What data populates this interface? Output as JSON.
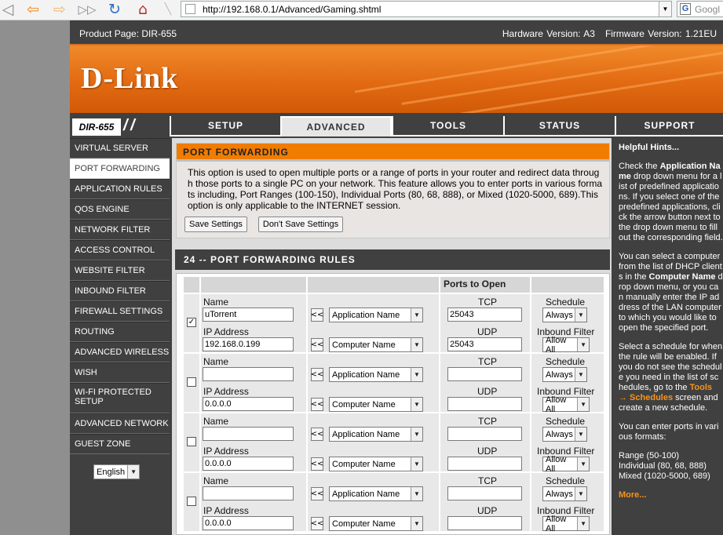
{
  "browser": {
    "url": "http://192.168.0.1/Advanced/Gaming.shtml",
    "search_placeholder": "Googl",
    "search_logo": "G"
  },
  "header": {
    "product": "Product Page: DIR-655",
    "hardware": "Hardware Version: A3",
    "firmware": "Firmware Version: 1.21EU",
    "logo": "D-Link",
    "model": "DIR-655"
  },
  "tabs": [
    "SETUP",
    "ADVANCED",
    "TOOLS",
    "STATUS",
    "SUPPORT"
  ],
  "active_tab": "ADVANCED",
  "nav": [
    "VIRTUAL SERVER",
    "PORT FORWARDING",
    "APPLICATION RULES",
    "QOS ENGINE",
    "NETWORK FILTER",
    "ACCESS CONTROL",
    "WEBSITE FILTER",
    "INBOUND FILTER",
    "FIREWALL SETTINGS",
    "ROUTING",
    "ADVANCED WIRELESS",
    "WISH",
    "WI-FI PROTECTED SETUP",
    "ADVANCED NETWORK",
    "GUEST ZONE"
  ],
  "active_nav": "PORT FORWARDING",
  "language": "English",
  "port_forwarding": {
    "title": "PORT FORWARDING",
    "description": "This option is used to open multiple ports or a range of ports in your router and redirect data through those ports to a single PC on your network. This feature allows you to enter ports in various formats including, Port Ranges (100-150), Individual Ports (80, 68, 888), or Mixed (1020-5000, 689).This option is only applicable to the INTERNET session.",
    "save_label": "Save Settings",
    "dont_save_label": "Don't Save Settings"
  },
  "rules": {
    "title": "24 -- PORT FORWARDING RULES",
    "ports_header": "Ports to Open",
    "labels": {
      "name": "Name",
      "ip": "IP Address",
      "tcp": "TCP",
      "udp": "UDP",
      "schedule": "Schedule",
      "inbound": "Inbound Filter",
      "move": "<<"
    },
    "rows": [
      {
        "checked": true,
        "name": "uTorrent",
        "ip": "192.168.0.199",
        "app": "Application Name",
        "computer": "Computer Name",
        "tcp": "25043",
        "udp": "25043",
        "schedule": "Always",
        "inbound": "Allow All"
      },
      {
        "checked": false,
        "name": "",
        "ip": "0.0.0.0",
        "app": "Application Name",
        "computer": "Computer Name",
        "tcp": "",
        "udp": "",
        "schedule": "Always",
        "inbound": "Allow All"
      },
      {
        "checked": false,
        "name": "",
        "ip": "0.0.0.0",
        "app": "Application Name",
        "computer": "Computer Name",
        "tcp": "",
        "udp": "",
        "schedule": "Always",
        "inbound": "Allow All"
      },
      {
        "checked": false,
        "name": "",
        "ip": "0.0.0.0",
        "app": "Application Name",
        "computer": "Computer Name",
        "tcp": "",
        "udp": "",
        "schedule": "Always",
        "inbound": "Allow All"
      }
    ]
  },
  "hints": {
    "title": "Helpful Hints...",
    "p1_a": "Check the ",
    "p1_b": "Application Name",
    "p1_c": " drop down menu for a list of predefined applications. If you select one of the predefined applications, click the arrow button next to the drop down menu to fill out the corresponding field.",
    "p2_a": "You can select a computer from the list of DHCP clients in the ",
    "p2_b": "Computer Name",
    "p2_c": " drop down menu, or you can manually enter the IP address of the LAN computer to which you would like to open the specified port.",
    "p3_a": "Select a schedule for when the rule will be enabled. If you do not see the schedule you need in the list of schedules, go to the ",
    "p3_b": "Tools → Schedules",
    "p3_c": " screen and create a new schedule.",
    "p4": "You can enter ports in various formats:",
    "f1": "Range (50-100)",
    "f2": "Individual (80, 68, 888)",
    "f3": "Mixed (1020-5000, 689)",
    "more": "More..."
  },
  "colors": {
    "orange": "#f07c00",
    "dark": "#404040"
  }
}
